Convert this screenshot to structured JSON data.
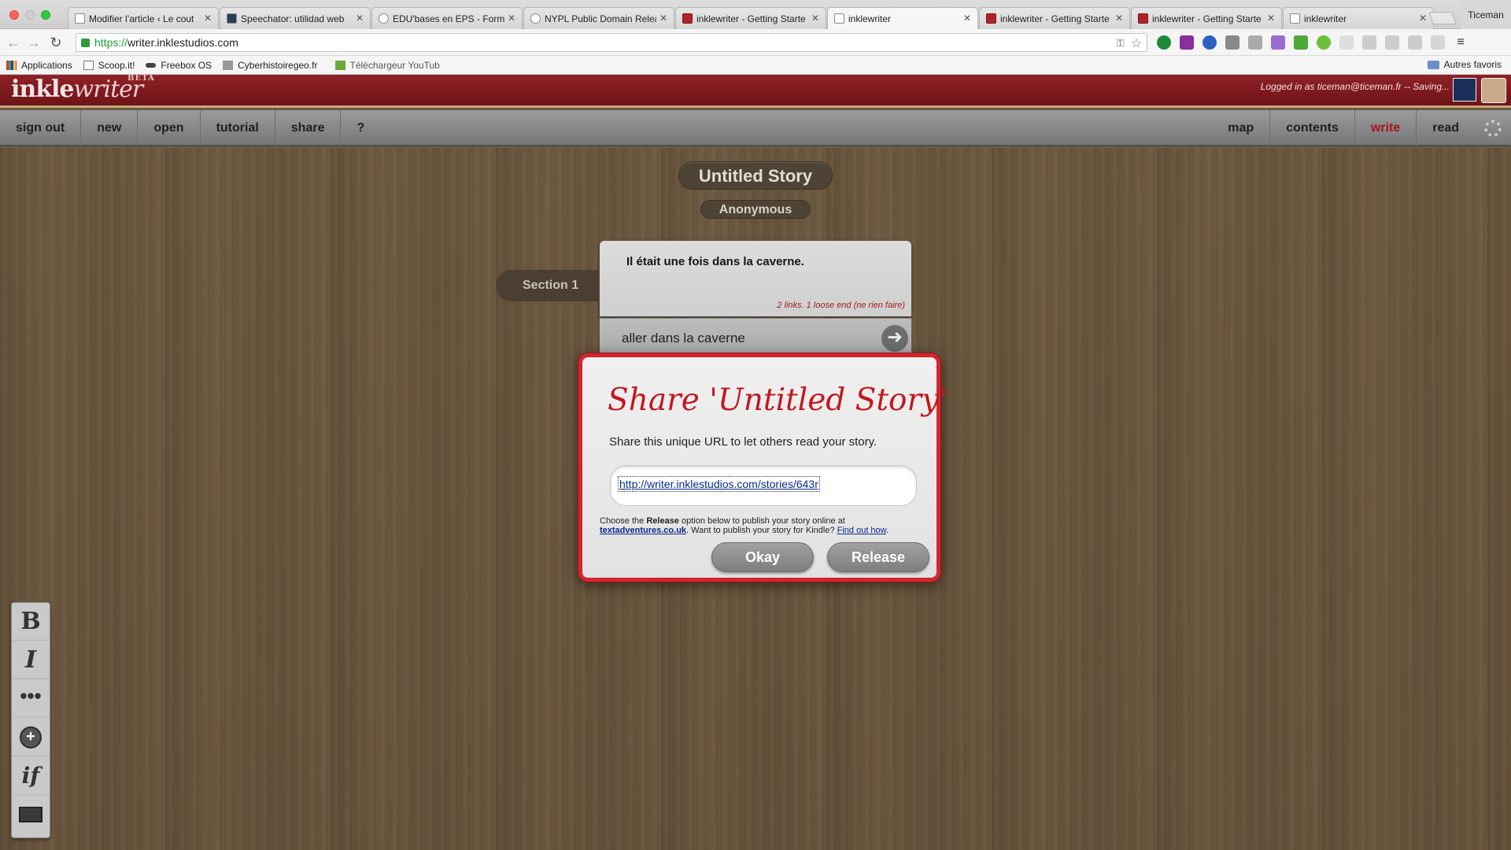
{
  "browser": {
    "tabs": [
      {
        "title": "Modifier l’article ‹ Le cout",
        "favicon": "page-icon"
      },
      {
        "title": "Speechator: utilidad web",
        "favicon": "speechator-icon"
      },
      {
        "title": "EDU'bases en EPS - Formu",
        "favicon": "edubases-icon"
      },
      {
        "title": "NYPL Public Domain Relea",
        "favicon": "nypl-icon"
      },
      {
        "title": "inklewriter - Getting Starte",
        "favicon": "inkle-icon"
      },
      {
        "title": "inklewriter",
        "favicon": "page-icon"
      },
      {
        "title": "inklewriter - Getting Starte",
        "favicon": "inkle-icon"
      },
      {
        "title": "inklewriter - Getting Starte",
        "favicon": "inkle-icon"
      },
      {
        "title": "inklewriter",
        "favicon": "page-icon"
      }
    ],
    "profile_name": "Ticeman",
    "url_scheme": "https://",
    "url_rest": "writer.inklestudios.com",
    "bookmarks": [
      {
        "label": "Applications",
        "icon": "apps-grid-icon"
      },
      {
        "label": "Scoop.it!",
        "icon": "page-icon"
      },
      {
        "label": "Freebox OS",
        "icon": "freebox-icon"
      },
      {
        "label": "Cyberhistoiregeo.fr",
        "icon": "cyber-icon"
      },
      {
        "label": "Téléchargeur YouTub",
        "icon": "download-icon"
      }
    ],
    "other_bookmarks": "Autres favoris"
  },
  "app": {
    "logo_main": "inkle",
    "logo_sub": "writer",
    "logo_beta": "BETA",
    "status": "Logged in as ticeman@ticeman.fr -- Saving...",
    "menu_left": [
      "sign out",
      "new",
      "open",
      "tutorial",
      "share",
      "?"
    ],
    "menu_right": [
      "map",
      "contents",
      "write",
      "read"
    ],
    "active_menu": "write"
  },
  "story": {
    "title": "Untitled Story",
    "author": "Anonymous",
    "section_label": "Section 1",
    "paragraph": "Il était une fois dans la caverne.",
    "meta": "2 links. 1 loose end (ne rien faire)",
    "choice": "aller dans la caverne"
  },
  "modal": {
    "title": "Share 'Untitled Story'",
    "description": "Share this unique URL to let others read your story.",
    "share_url": "http://writer.inklestudios.com/stories/643r",
    "note_prefix": "Choose the ",
    "note_bold": "Release",
    "note_mid": " option below to publish your story online at ",
    "note_link": "textadventures.co.uk",
    "note_suffix": ". Want to publish your story for Kindle? ",
    "note_link2": "Find out how",
    "note_end": ".",
    "okay_label": "Okay",
    "release_label": "Release"
  },
  "format_tools": {
    "bold": "B",
    "italic": "I",
    "dots": "•••",
    "plus": "+",
    "if": "if"
  },
  "colors": {
    "header_red": "#8f2126",
    "accent_red": "#c2181f",
    "active_menu": "#a4161d",
    "link_blue": "#0a2a8c"
  }
}
